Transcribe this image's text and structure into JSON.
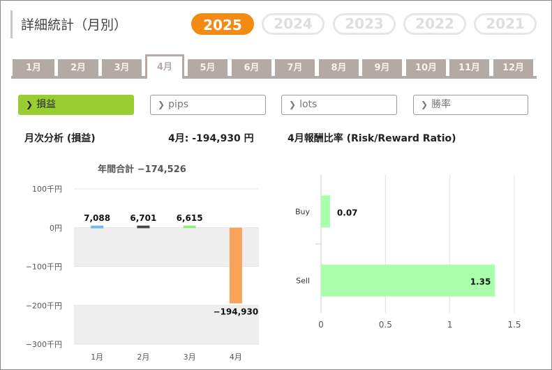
{
  "header": {
    "title": "詳細統計（月別）"
  },
  "years": [
    {
      "label": "2025",
      "active": true
    },
    {
      "label": "2024",
      "active": false
    },
    {
      "label": "2023",
      "active": false
    },
    {
      "label": "2022",
      "active": false
    },
    {
      "label": "2021",
      "active": false
    }
  ],
  "months": [
    "1月",
    "2月",
    "3月",
    "4月",
    "5月",
    "6月",
    "7月",
    "8月",
    "9月",
    "10月",
    "11月",
    "12月"
  ],
  "active_month": "4月",
  "metric_tabs": [
    {
      "label": "損益",
      "active": true
    },
    {
      "label": "pips",
      "active": false
    },
    {
      "label": "lots",
      "active": false
    },
    {
      "label": "勝率",
      "active": false
    }
  ],
  "section": {
    "left_title": "月次分析 (損益)",
    "month_total_label": "4月:",
    "month_total_value": "-194,930 円",
    "right_title": "4月報酬比率 (Risk/Reward Ratio)"
  },
  "colors": {
    "year_active": "#f38a12",
    "tab_active": "#9acd32",
    "month_tab": "#b5a9a5"
  },
  "chart_data": [
    {
      "type": "bar",
      "title": "年間合計 −174,526",
      "categories": [
        "1月",
        "2月",
        "3月",
        "4月"
      ],
      "values": [
        7088,
        6701,
        6615,
        -194930
      ],
      "value_labels": [
        "7,088",
        "6,701",
        "6,615",
        "−194,930"
      ],
      "bar_colors": [
        "#7cb5ec",
        "#434348",
        "#90ed7d",
        "#f7a35c"
      ],
      "ylim": [
        -300000,
        100000
      ],
      "yticks": [
        100000,
        0,
        -100000,
        -200000,
        -300000
      ],
      "ytick_labels": [
        "100千円",
        "0円",
        "−100千円",
        "−200千円",
        "−300千円"
      ]
    },
    {
      "type": "bar",
      "orientation": "horizontal",
      "categories": [
        "Buy",
        "Sell"
      ],
      "values": [
        0.07,
        1.35
      ],
      "value_labels": [
        "0.07",
        "1.35"
      ],
      "bar_color": "#aaffaa",
      "xlim": [
        0,
        1.5
      ],
      "xticks": [
        0,
        0.5,
        1,
        1.5
      ],
      "xtick_labels": [
        "0",
        "0.5",
        "1",
        "1.5"
      ]
    }
  ]
}
